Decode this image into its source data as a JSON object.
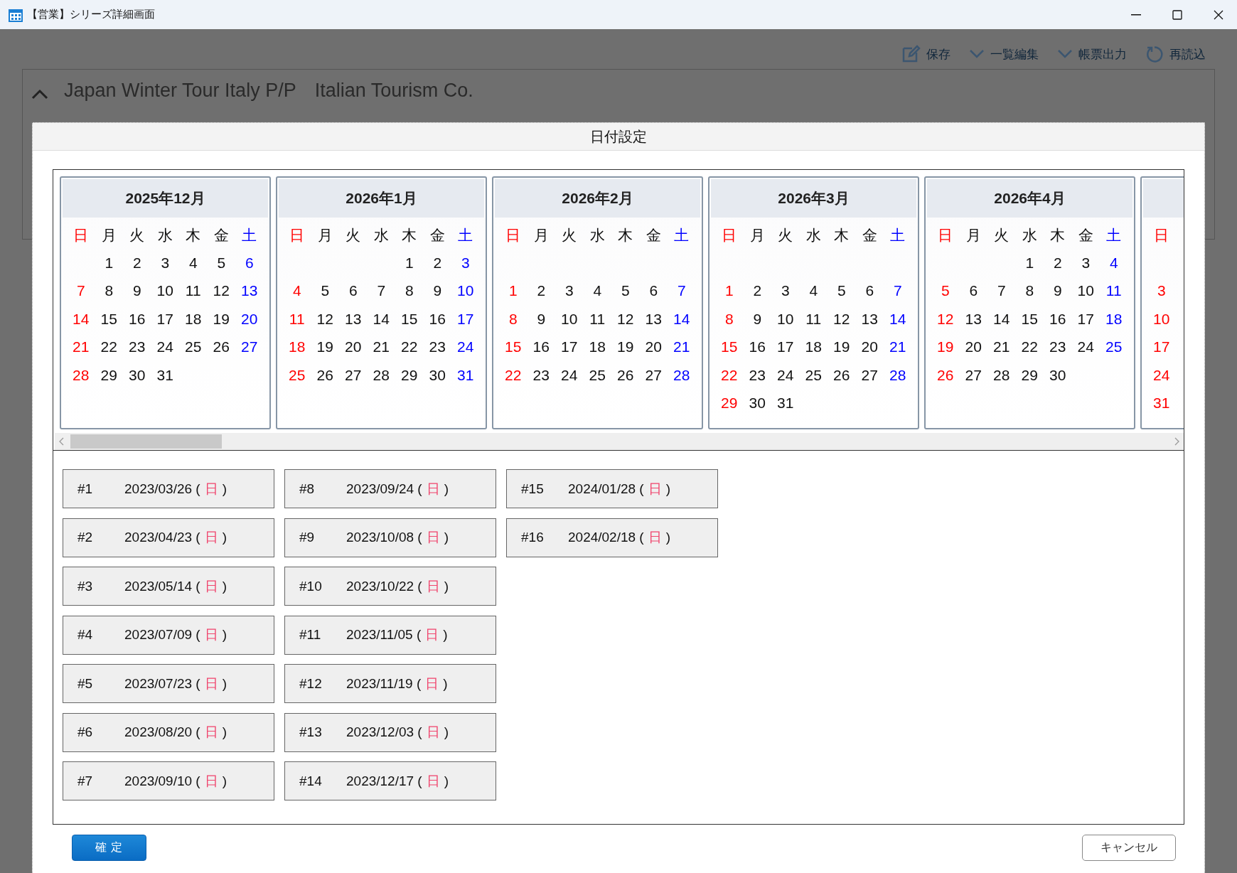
{
  "window": {
    "title": "【営業】シリーズ詳細画面"
  },
  "toolbar": [
    {
      "kind": "edit",
      "label": "保存"
    },
    {
      "kind": "chevron",
      "label": "一覧編集"
    },
    {
      "kind": "chevron",
      "label": "帳票出力"
    },
    {
      "kind": "reload",
      "label": "再読込"
    }
  ],
  "header": {
    "expanded": true,
    "tour": "Japan Winter Tour Italy P/P",
    "company": "Italian Tourism Co."
  },
  "dialog": {
    "title": "日付設定",
    "calendars": [
      {
        "title": "2025年12月",
        "weekdays": [
          "日",
          "月",
          "火",
          "水",
          "木",
          "金",
          "土"
        ],
        "weeks": [
          [
            "1",
            "2",
            "3",
            "4",
            "5",
            "6"
          ],
          [
            "7",
            "8",
            "9",
            "10",
            "11",
            "12",
            "13"
          ],
          [
            "14",
            "15",
            "16",
            "17",
            "18",
            "19",
            "20"
          ],
          [
            "21",
            "22",
            "23",
            "24",
            "25",
            "26",
            "27"
          ],
          [
            "28",
            "29",
            "30",
            "31"
          ]
        ]
      },
      {
        "title": "2026年1月",
        "weekdays": [
          "日",
          "月",
          "火",
          "水",
          "木",
          "金",
          "土"
        ],
        "weeks": [
          [
            "1",
            "2",
            "3"
          ],
          [
            "4",
            "5",
            "6",
            "7",
            "8",
            "9",
            "10"
          ],
          [
            "11",
            "12",
            "13",
            "14",
            "15",
            "16",
            "17"
          ],
          [
            "18",
            "19",
            "20",
            "21",
            "22",
            "23",
            "24"
          ],
          [
            "25",
            "26",
            "27",
            "28",
            "29",
            "30",
            "31"
          ]
        ]
      },
      {
        "title": "2026年2月",
        "weekdays": [
          "日",
          "月",
          "火",
          "水",
          "木",
          "金",
          "土"
        ],
        "blank_first_row": true,
        "weeks": [
          [
            "1",
            "2",
            "3",
            "4",
            "5",
            "6",
            "7"
          ],
          [
            "8",
            "9",
            "10",
            "11",
            "12",
            "13",
            "14"
          ],
          [
            "15",
            "16",
            "17",
            "18",
            "19",
            "20",
            "21"
          ],
          [
            "22",
            "23",
            "24",
            "25",
            "26",
            "27",
            "28"
          ]
        ]
      },
      {
        "title": "2026年3月",
        "weekdays": [
          "日",
          "月",
          "火",
          "水",
          "木",
          "金",
          "土"
        ],
        "blank_first_row": true,
        "weeks": [
          [
            "1",
            "2",
            "3",
            "4",
            "5",
            "6",
            "7"
          ],
          [
            "8",
            "9",
            "10",
            "11",
            "12",
            "13",
            "14"
          ],
          [
            "15",
            "16",
            "17",
            "18",
            "19",
            "20",
            "21"
          ],
          [
            "22",
            "23",
            "24",
            "25",
            "26",
            "27",
            "28"
          ],
          [
            "29",
            "30",
            "31"
          ]
        ]
      },
      {
        "title": "2026年4月",
        "weekdays": [
          "日",
          "月",
          "火",
          "水",
          "木",
          "金",
          "土"
        ],
        "weeks": [
          [
            "1",
            "2",
            "3",
            "4"
          ],
          [
            "5",
            "6",
            "7",
            "8",
            "9",
            "10",
            "11"
          ],
          [
            "12",
            "13",
            "14",
            "15",
            "16",
            "17",
            "18"
          ],
          [
            "19",
            "20",
            "21",
            "22",
            "23",
            "24",
            "25"
          ],
          [
            "26",
            "27",
            "28",
            "29",
            "30"
          ]
        ]
      },
      {
        "weekdays": [
          "日"
        ],
        "blank_first_row": true,
        "weeks": [
          [
            "3"
          ],
          [
            "10"
          ],
          [
            "17"
          ],
          [
            "24"
          ],
          [
            "31"
          ]
        ]
      }
    ],
    "dates": [
      {
        "label": "#1",
        "date": "2023/03/26 (",
        "weekday": "日",
        "tail": ")"
      },
      {
        "label": "#2",
        "date": "2023/04/23 (",
        "weekday": "日",
        "tail": ")"
      },
      {
        "label": "#3",
        "date": "2023/05/14 (",
        "weekday": "日",
        "tail": ")"
      },
      {
        "label": "#4",
        "date": "2023/07/09 (",
        "weekday": "日",
        "tail": ")"
      },
      {
        "label": "#5",
        "date": "2023/07/23 (",
        "weekday": "日",
        "tail": ")"
      },
      {
        "label": "#6",
        "date": "2023/08/20 (",
        "weekday": "日",
        "tail": ")"
      },
      {
        "label": "#7",
        "date": "2023/09/10 (",
        "weekday": "日",
        "tail": ")"
      },
      {
        "label": "#8",
        "date": "2023/09/24 (",
        "weekday": "日",
        "tail": ")"
      },
      {
        "label": "#9",
        "date": "2023/10/08 (",
        "weekday": "日",
        "tail": ")"
      },
      {
        "label": "#10",
        "date": "2023/10/22 (",
        "weekday": "日",
        "tail": ")"
      },
      {
        "label": "#11",
        "date": "2023/11/05 (",
        "weekday": "日",
        "tail": ")"
      },
      {
        "label": "#12",
        "date": "2023/11/19 (",
        "weekday": "日",
        "tail": ")"
      },
      {
        "label": "#13",
        "date": "2023/12/03 (",
        "weekday": "日",
        "tail": ")"
      },
      {
        "label": "#14",
        "date": "2023/12/17 (",
        "weekday": "日",
        "tail": ")"
      },
      {
        "label": "#15",
        "date": "2024/01/28 (",
        "weekday": "日",
        "tail": ")"
      },
      {
        "label": "#16",
        "date": "2024/02/18 (",
        "weekday": "日",
        "tail": ")"
      }
    ],
    "confirm": "確 定",
    "cancel": "キャンセル"
  }
}
